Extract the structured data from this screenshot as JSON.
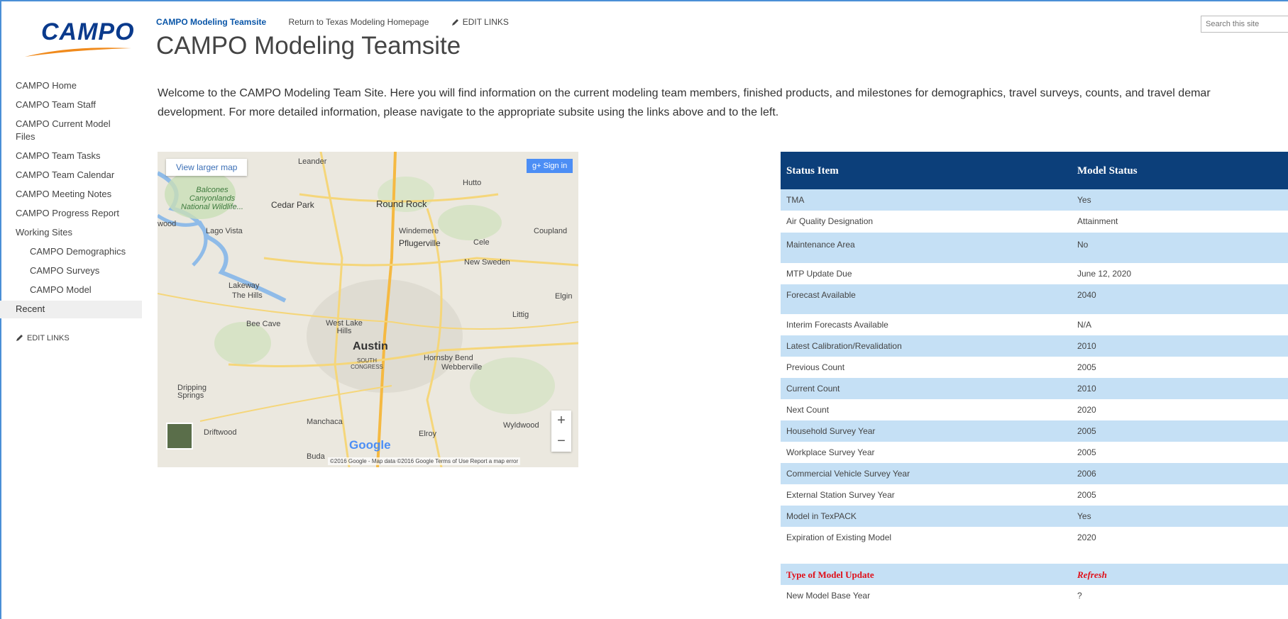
{
  "colors": {
    "accent": "#0a56a8",
    "frame": "#4b8fd6",
    "table_header": "#0c3f7a",
    "row_alt": "#c5e0f5",
    "highlight": "#e0101a"
  },
  "logo": {
    "text": "CAMPO"
  },
  "topnav": {
    "items": [
      "CAMPO Modeling Teamsite",
      "Return to Texas Modeling Homepage"
    ],
    "edit_links": "EDIT LINKS"
  },
  "search": {
    "placeholder": "Search this site"
  },
  "page_title": "CAMPO Modeling Teamsite",
  "welcome": {
    "line1": "Welcome to the CAMPO Modeling Team Site. Here you will find information on the current modeling team members, finished products, and milestones for demographics, travel surveys, counts, and travel demar",
    "line2": "development. For more detailed information, please navigate to the appropriate subsite using the links above and to the left."
  },
  "leftnav": {
    "items": [
      "CAMPO Home",
      "CAMPO Team Staff",
      "CAMPO Current Model Files",
      "CAMPO Team Tasks",
      "CAMPO Team Calendar",
      "CAMPO Meeting Notes",
      "CAMPO Progress Report",
      "Working Sites"
    ],
    "subitems": [
      "CAMPO Demographics",
      "CAMPO Surveys",
      "CAMPO Model"
    ],
    "recent": "Recent",
    "edit_links": "EDIT LINKS"
  },
  "map": {
    "view_larger": "View larger map",
    "sign_in": "Sign in",
    "google": "Google",
    "footer": "©2016 Google - Map data ©2016 Google   Terms of Use   Report a map error",
    "labels": {
      "leander": "Leander",
      "hutto": "Hutto",
      "cedar_park": "Cedar Park",
      "round_rock": "Round Rock",
      "balcones": "Balcones Canyonlands National Wildlife...",
      "lago_vista": "Lago Vista",
      "windemere": "Windemere",
      "pflugerville": "Pflugerville",
      "cele": "Cele",
      "coupland": "Coupland",
      "new_sweden": "New Sweden",
      "lakeway": "Lakeway",
      "the_hills": "The Hills",
      "elgin": "Elgin",
      "littig": "Littig",
      "bee_cave": "Bee Cave",
      "west_lake_hills": "West Lake Hills",
      "austin": "Austin",
      "hornsby_bend": "Hornsby Bend",
      "webberville": "Webberville",
      "south_congress": "SOUTH CONGRESS",
      "dripping_springs": "Dripping Springs",
      "manchaca": "Manchaca",
      "driftwood": "Driftwood",
      "elroy": "Elroy",
      "wyldwood": "Wyldwood",
      "buda": "Buda",
      "wood": "wood"
    }
  },
  "status_table": {
    "headers": [
      "Status Item",
      "Model Status"
    ],
    "rows": [
      {
        "item": "TMA",
        "status": "Yes"
      },
      {
        "item": "Air Quality Designation",
        "status": "Attainment"
      },
      {
        "item": "Maintenance Area",
        "status": "No"
      },
      {
        "item": "MTP Update Due",
        "status": "June 12, 2020"
      },
      {
        "item": "Forecast Available",
        "status": "2040"
      },
      {
        "item": "Interim Forecasts Available",
        "status": "N/A"
      },
      {
        "item": "Latest Calibration/Revalidation",
        "status": "2010"
      },
      {
        "item": "Previous Count",
        "status": "2005"
      },
      {
        "item": "Current Count",
        "status": "2010"
      },
      {
        "item": "Next Count",
        "status": "2020"
      },
      {
        "item": "Household Survey Year",
        "status": "2005"
      },
      {
        "item": "Workplace Survey Year",
        "status": "2005"
      },
      {
        "item": "Commercial Vehicle Survey Year",
        "status": "2006"
      },
      {
        "item": "External Station Survey Year",
        "status": "2005"
      },
      {
        "item": "Model in TexPACK",
        "status": "Yes"
      },
      {
        "item": "Expiration of Existing Model",
        "status": "2020"
      },
      {
        "item": "Type of Model Update",
        "status": "Refresh"
      },
      {
        "item": "New Model Base Year",
        "status": "?"
      }
    ]
  }
}
